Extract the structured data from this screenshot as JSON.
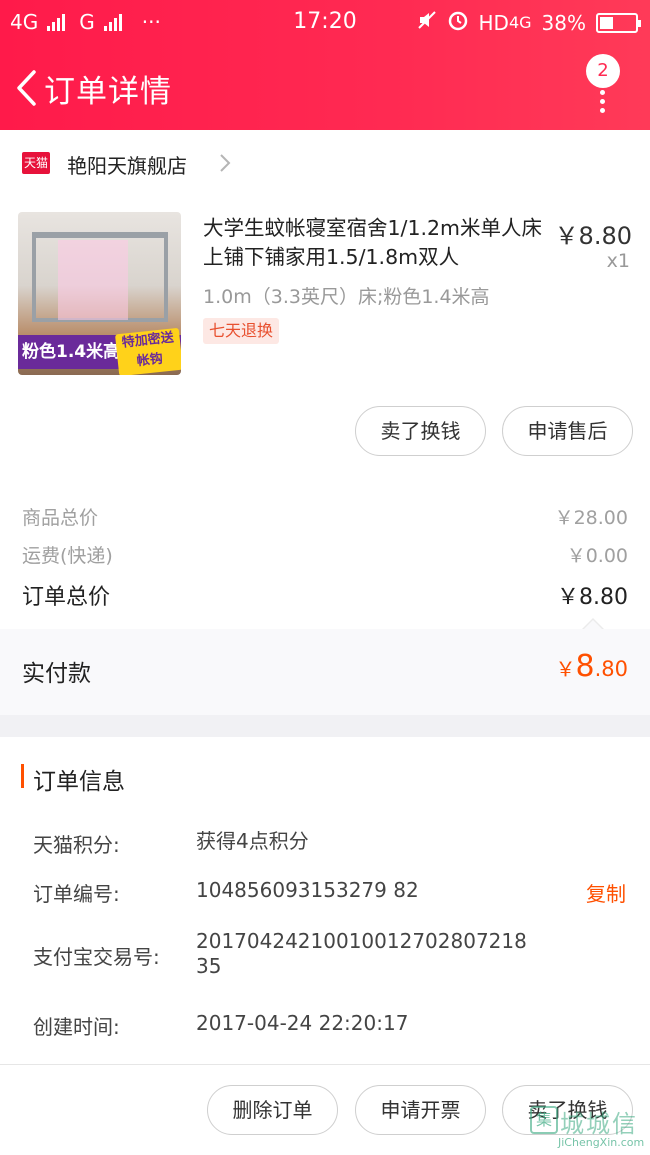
{
  "status_bar": {
    "network1": "4G",
    "network2": "G",
    "more": "···",
    "time": "17:20",
    "hd": "HD",
    "net_right": "4G",
    "battery": "38%"
  },
  "nav": {
    "title": "订单详情",
    "badge_count": "2"
  },
  "shop": {
    "logo": "天猫",
    "name": "艳阳天旗舰店"
  },
  "product": {
    "image_banner": "粉色1.4米高",
    "image_tag": "特加密送帐钩",
    "title": "大学生蚊帐寝室宿舍1/1.2m米单人床上铺下铺家用1.5/1.8m双人",
    "price": "￥8.80",
    "qty": "x1",
    "sku": "1.0m（3.3英尺）床;粉色1.4米高",
    "return_tag": "七天退换"
  },
  "item_buttons": {
    "sell": "卖了换钱",
    "after_sale": "申请售后"
  },
  "summary": {
    "goods_total_label": "商品总价",
    "goods_total": "￥28.00",
    "shipping_label": "运费(快递)",
    "shipping": "￥0.00",
    "order_total_label": "订单总价",
    "order_total": "￥8.80",
    "paid_label": "实付款",
    "paid_currency": "￥",
    "paid_int": "8",
    "paid_dec": ".80"
  },
  "order_info": {
    "heading": "订单信息",
    "points_label": "天猫积分:",
    "points_value": "获得4点积分",
    "order_no_label": "订单编号:",
    "order_no": "104856093153279 82",
    "copy": "复制",
    "alipay_label": "支付宝交易号:",
    "alipay_no": "20170424210010012702807218 35",
    "created_label": "创建时间:",
    "created": "2017-04-24 22:20:17"
  },
  "bottom_buttons": {
    "delete": "删除订单",
    "invoice": "申请开票",
    "sell": "卖了换钱"
  },
  "watermark": {
    "cn": "城城信",
    "en": "JiChengXin.com"
  },
  "colors": {
    "header": "#ff2a52",
    "accent": "#ff5000"
  }
}
